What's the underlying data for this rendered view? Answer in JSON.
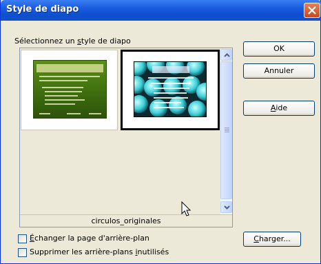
{
  "window": {
    "title": "Style de diapo"
  },
  "prompt": {
    "before": "Sélectionnez un ",
    "access": "s",
    "after": "tyle de diapo"
  },
  "gallery": {
    "items": [
      {
        "name": "green-template",
        "selected": false
      },
      {
        "name": "circulos_originales",
        "selected": true
      }
    ],
    "caption": "circulos_originales"
  },
  "buttons": {
    "ok": "OK",
    "cancel": "Annuler",
    "help_access": "A",
    "help_rest": "ide",
    "load_access": "C",
    "load_rest": "harger..."
  },
  "options": {
    "exchange_access": "É",
    "exchange_rest": "changer la page d'arrière-plan",
    "exchange_checked": false,
    "delete_before": "Supprimer les arrière-plans ",
    "delete_access": "i",
    "delete_after": "nutilisés",
    "delete_checked": false
  },
  "icons": {
    "close": "close-icon",
    "scroll_up": "scroll-up-icon",
    "scroll_down": "scroll-down-icon",
    "cursor": "mouse-pointer-icon"
  },
  "colors": {
    "title_bar": "#1d5fe0",
    "selection_border": "#000000",
    "dialog_bg": "#ece9d8"
  }
}
